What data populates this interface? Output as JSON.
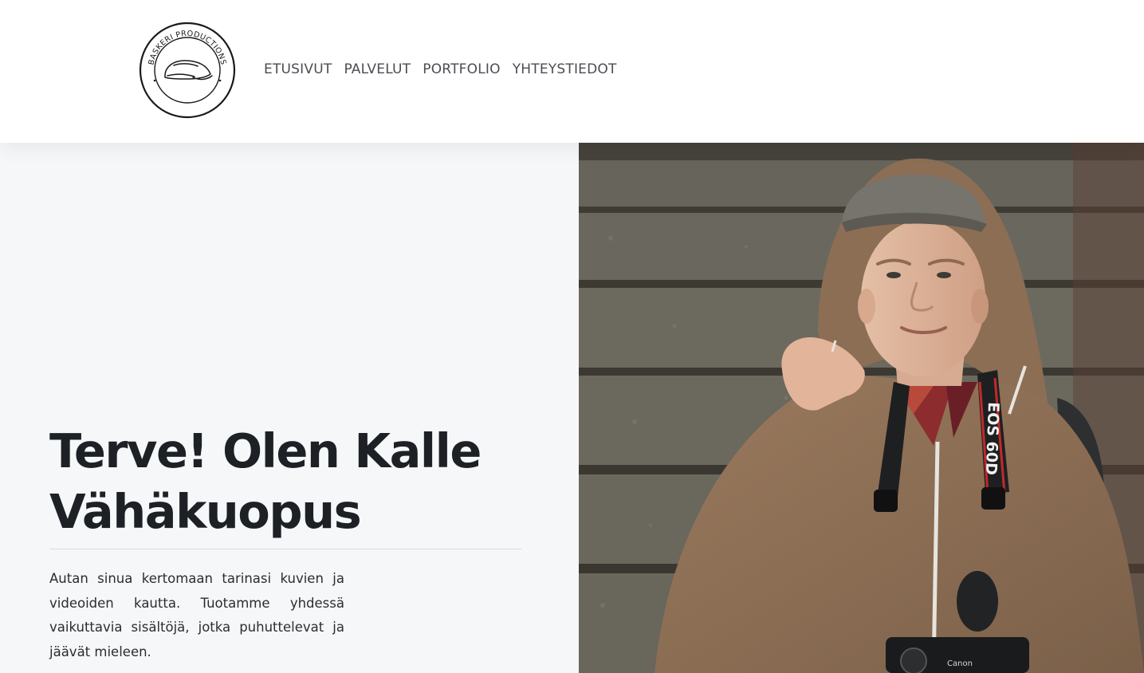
{
  "brand": {
    "logo_text": "BASKERI PRODUCTIONS",
    "logo_icon": "flat-cap-icon"
  },
  "nav": {
    "items": [
      {
        "label": "ETUSIVUT"
      },
      {
        "label": "PALVELUT"
      },
      {
        "label": "PORTFOLIO"
      },
      {
        "label": "YHTEYSTIEDOT"
      }
    ]
  },
  "hero": {
    "title_line1": "Terve! Olen Kalle",
    "title_line2": "Vähäkuopus",
    "body": "Autan sinua kertomaan tarinasi kuvien ja videoiden kautta. Tuotamme yhdessä vaikuttavia sisältöjä, jotka puhuttelevat ja jäävät mieleen.",
    "photo": {
      "camera_strap_text": "EOS 60D",
      "camera_brand_text": "Canon"
    }
  },
  "colors": {
    "hero_background": "#f6f7f9",
    "heading": "#1d2125",
    "nav_text": "#4a4d52",
    "divider": "#d9dbde"
  }
}
